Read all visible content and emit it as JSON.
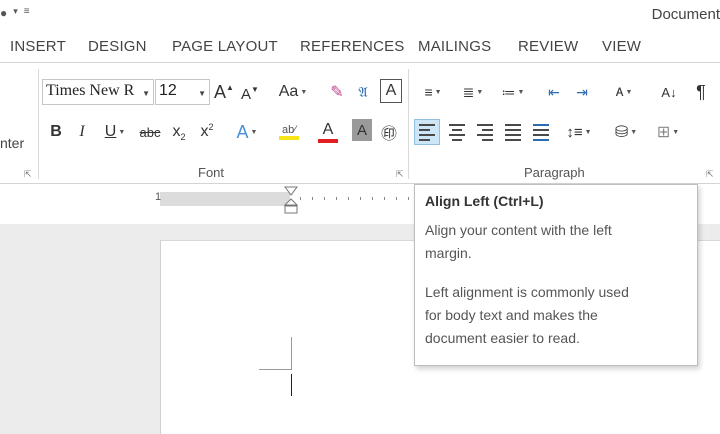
{
  "title_bar": {
    "document_title": "Document"
  },
  "tabs": [
    "INSERT",
    "DESIGN",
    "PAGE LAYOUT",
    "REFERENCES",
    "MAILINGS",
    "REVIEW",
    "VIEW"
  ],
  "ribbon": {
    "partial_group_label": "nter",
    "font_name": "Times New R",
    "font_size": "12",
    "groups": {
      "font": "Font",
      "paragraph": "Paragraph"
    },
    "font_buttons": {
      "grow": "A",
      "shrink": "A",
      "change_case": "Aa",
      "bold": "B",
      "italic": "I",
      "underline": "U",
      "strikethrough": "abc",
      "subscript": "x",
      "superscript": "x",
      "font_color": "A",
      "shade": "A",
      "text_effects": "A"
    },
    "paragraph_buttons": {
      "sort": "A↓",
      "pilcrow": "¶"
    }
  },
  "ruler": {
    "start_number": "1"
  },
  "tooltip": {
    "title": "Align Left (Ctrl+L)",
    "line1": "Align your content with the left",
    "line2": "margin.",
    "line3": "Left alignment is commonly used",
    "line4": "for body text and makes the",
    "line5": "document easier to read."
  },
  "colors": {
    "highlight": "#f5e416",
    "font_color": "#e02020",
    "selected": "#cde6f7",
    "accent": "#2b579a"
  }
}
